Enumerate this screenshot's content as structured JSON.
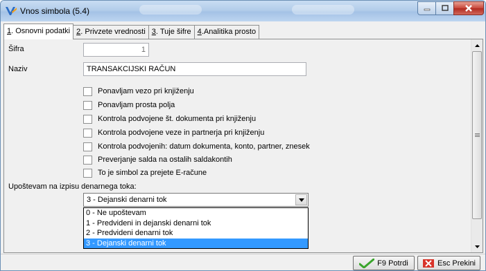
{
  "window": {
    "title": "Vnos simbola  (5.4)",
    "accent": "#a4c2e6"
  },
  "tabs": [
    {
      "key": "1",
      "label": ". Osnovni podatki"
    },
    {
      "key": "2",
      "label": ". Privzete vrednosti"
    },
    {
      "key": "3",
      "label": ". Tuje šifre"
    },
    {
      "key": "4",
      "label": ".Analitika prosto"
    }
  ],
  "form": {
    "sifra_label": "Šifra",
    "sifra_value": "1",
    "naziv_label": "Naziv",
    "naziv_value": "TRANSAKCIJSKI RAČUN",
    "checkboxes": [
      "Ponavljam vezo pri knjiženju",
      "Ponavljam prosta polja",
      "Kontrola podvojene št. dokumenta pri knjiženju",
      "Kontrola podvojene veze in partnerja pri knjiženju",
      "Kontrola podvojenih: datum dokumenta, konto, partner, znesek",
      "Preverjanje salda na ostalih saldakontih",
      "To je simbol za prejete E-račune"
    ],
    "cashflow_label": "Upoštevam na izpisu denarnega toka:",
    "cashflow_value": "3 - Dejanski denarni tok",
    "cashflow_options": [
      "0 - Ne upoštevam",
      "1 - Predvideni in dejanski denarni tok",
      "2 - Predvideni denarni tok",
      "3 - Dejanski denarni tok"
    ],
    "cashflow_selected_color": "#3399ff"
  },
  "footer": {
    "confirm_label": "F9 Potrdi",
    "cancel_label": "Esc Prekini"
  }
}
